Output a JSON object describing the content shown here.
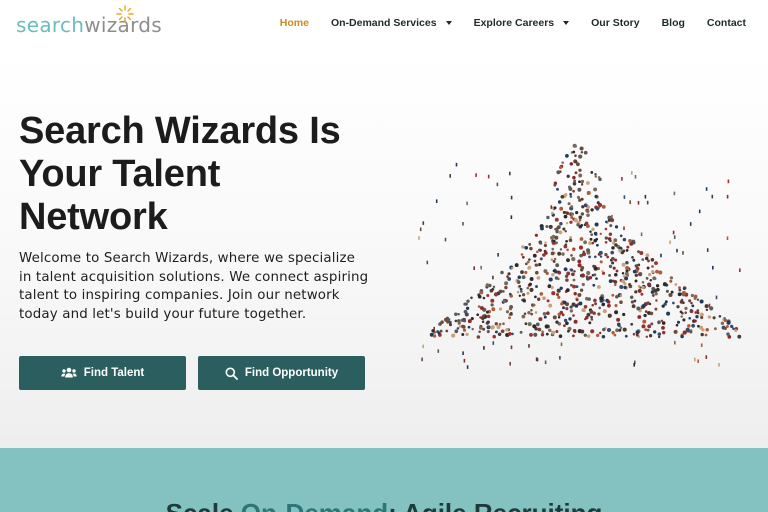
{
  "logo": {
    "part1": "search",
    "part2": "wizards"
  },
  "nav": {
    "items": [
      {
        "label": "Home",
        "active": true,
        "dropdown": false
      },
      {
        "label": "On-Demand Services",
        "active": false,
        "dropdown": true
      },
      {
        "label": "Explore Careers",
        "active": false,
        "dropdown": true
      },
      {
        "label": "Our Story",
        "active": false,
        "dropdown": false
      },
      {
        "label": "Blog",
        "active": false,
        "dropdown": false
      },
      {
        "label": "Contact",
        "active": false,
        "dropdown": false
      }
    ]
  },
  "hero": {
    "title": "Search Wizards Is Your Talent Network",
    "description": "Welcome to Search Wizards, where we specialize in talent acquisition solutions. We connect aspiring talent to inspiring companies. Join our network today and let's build your future together.",
    "buttons": {
      "talent": {
        "label": "Find Talent",
        "icon": "users-icon"
      },
      "opportunity": {
        "label": "Find Opportunity",
        "icon": "search-icon"
      }
    },
    "image": "crowd-arrow-illustration"
  },
  "section": {
    "title_part1": "Scale",
    "title_accent": "On-Demand",
    "title_part2": ": Agile Recruiting"
  },
  "colors": {
    "accent": "#c98a1e",
    "button": "#2b5f5f",
    "band": "#83c2c1",
    "logo_teal": "#6bbcbc"
  }
}
